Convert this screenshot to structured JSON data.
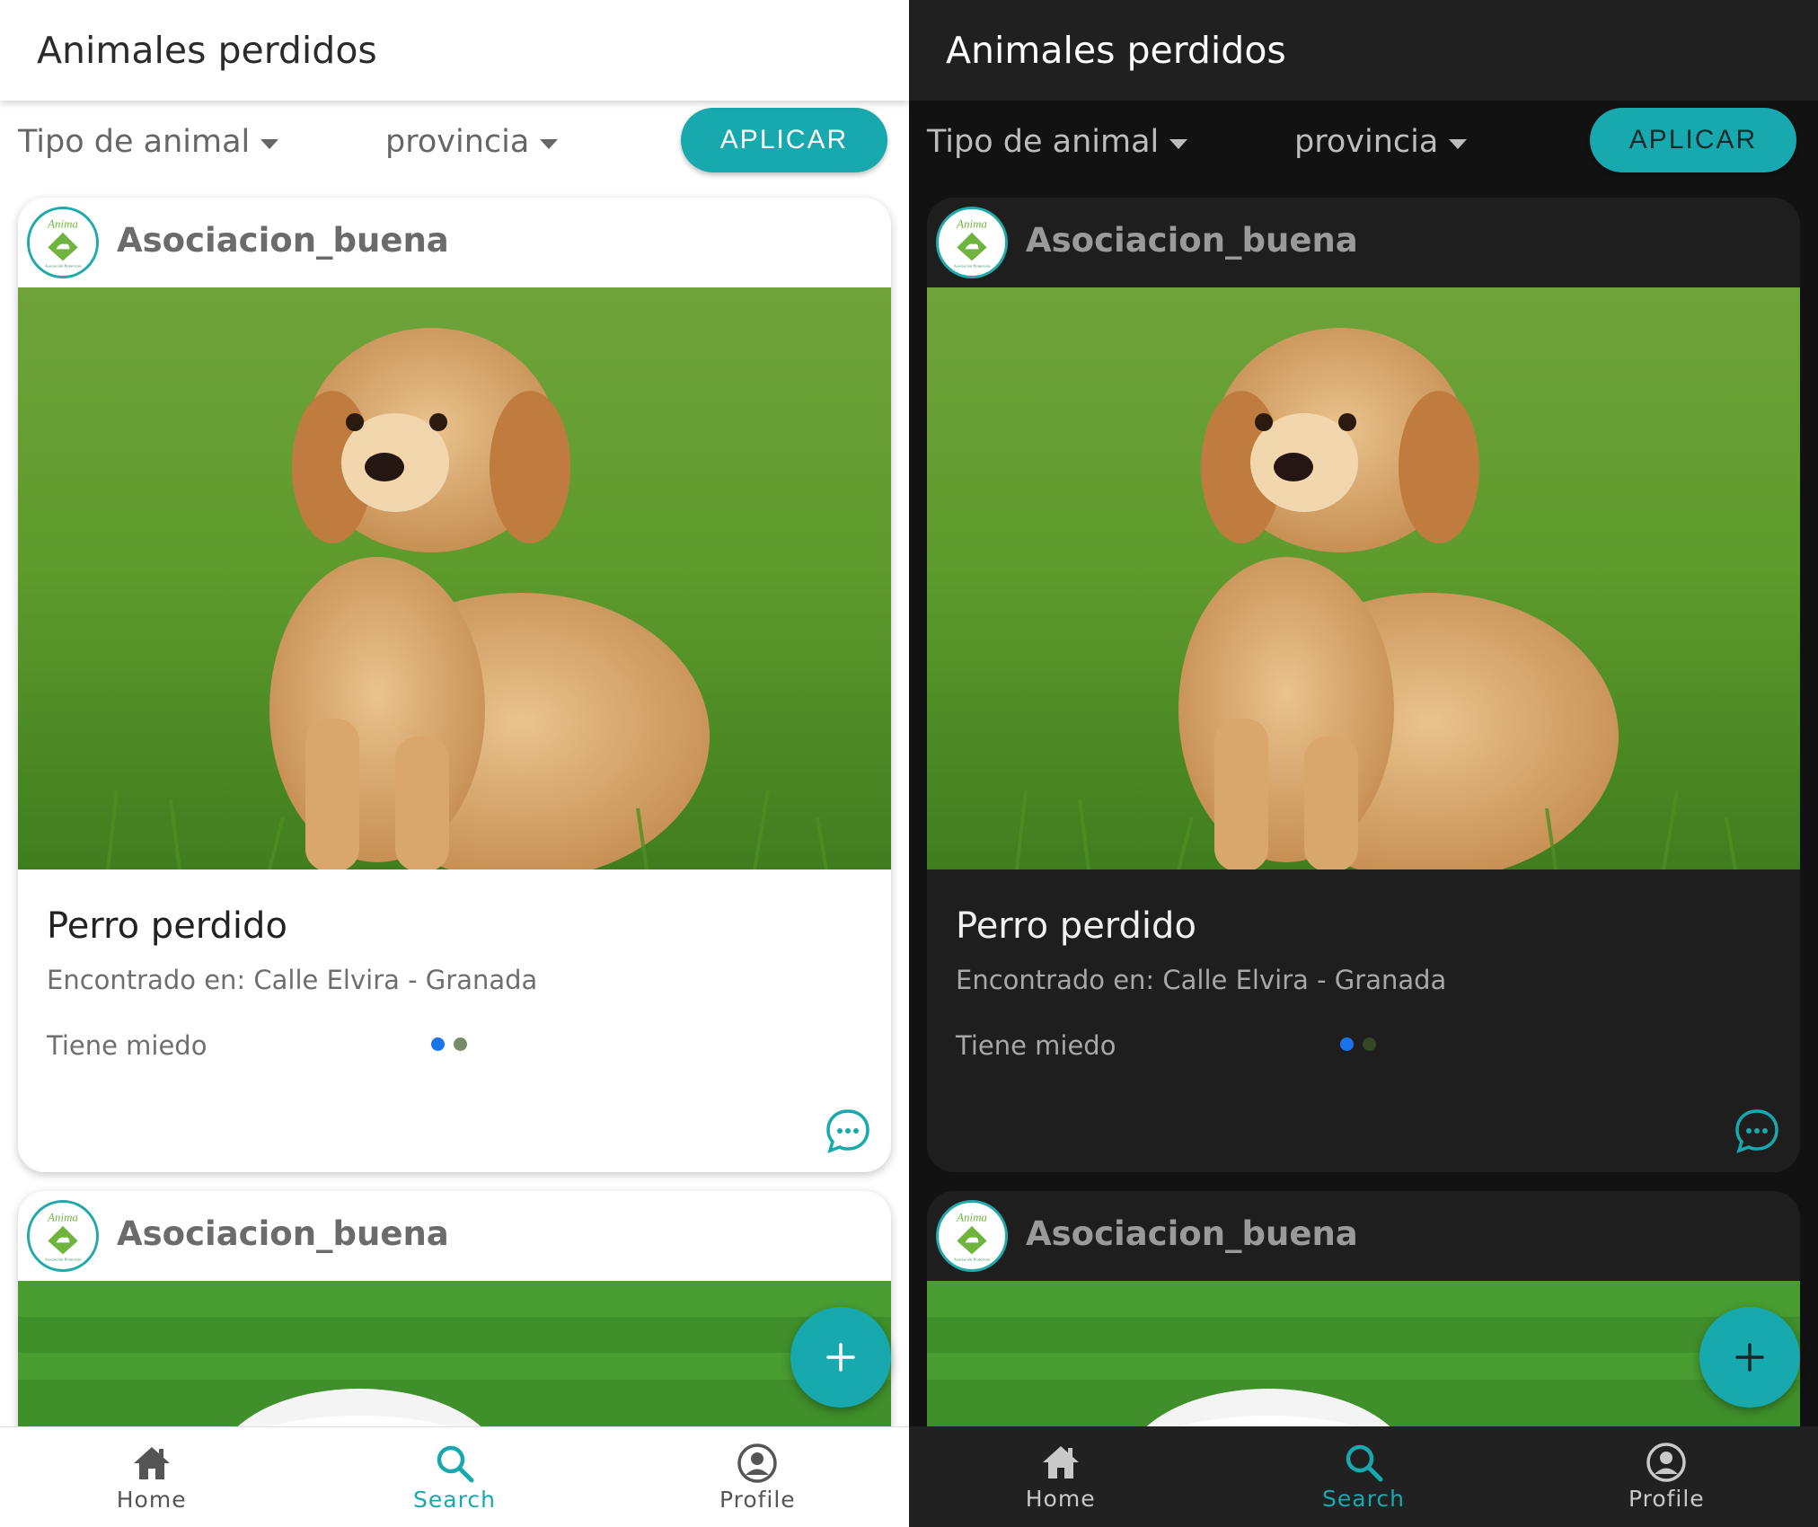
{
  "app": {
    "title": "Animales perdidos"
  },
  "filters": {
    "animal_type": "Tipo de animal",
    "province": "provincia",
    "apply_label": "APLICAR"
  },
  "posts": [
    {
      "org_name": "Asociacion_buena",
      "title": "Perro perdido",
      "location": "Encontrado en: Calle Elvira - Granada",
      "description": "Tiene miedo"
    },
    {
      "org_name": "Asociacion_buena"
    }
  ],
  "nav": {
    "home": "Home",
    "search": "Search",
    "profile": "Profile",
    "active": "search"
  },
  "colors": {
    "accent": "#17a9ad",
    "indicator": "#1a73e8",
    "dark_bg": "#121212",
    "dark_card": "#1e1e1e"
  },
  "icons": [
    "chat-bubble-icon",
    "plus-icon",
    "home-icon",
    "search-icon",
    "profile-icon",
    "caret-down-icon"
  ]
}
